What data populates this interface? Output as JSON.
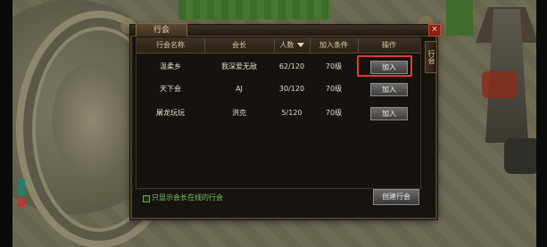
{
  "panel": {
    "tab_label": "行会",
    "close_label": "×",
    "side_tab_label": "行会"
  },
  "table": {
    "headers": [
      "行会名称",
      "会长",
      "人数",
      "加入条件",
      "操作"
    ],
    "rows": [
      {
        "guild": "温柔乡",
        "leader": "我深爱无敌",
        "members": "62/120",
        "requirement": "70级",
        "action": "加入"
      },
      {
        "guild": "天下会",
        "leader": "AJ",
        "members": "30/120",
        "requirement": "70级",
        "action": "加入"
      },
      {
        "guild": "屠龙玩玩",
        "leader": "洪克",
        "members": "5/120",
        "requirement": "70级",
        "action": "加入"
      }
    ]
  },
  "footer": {
    "filter_label": "只显示会长在线的行会",
    "create_label": "创建行会"
  },
  "colors": {
    "highlight": "#e13a3a",
    "filter_text": "#7cc45a"
  }
}
